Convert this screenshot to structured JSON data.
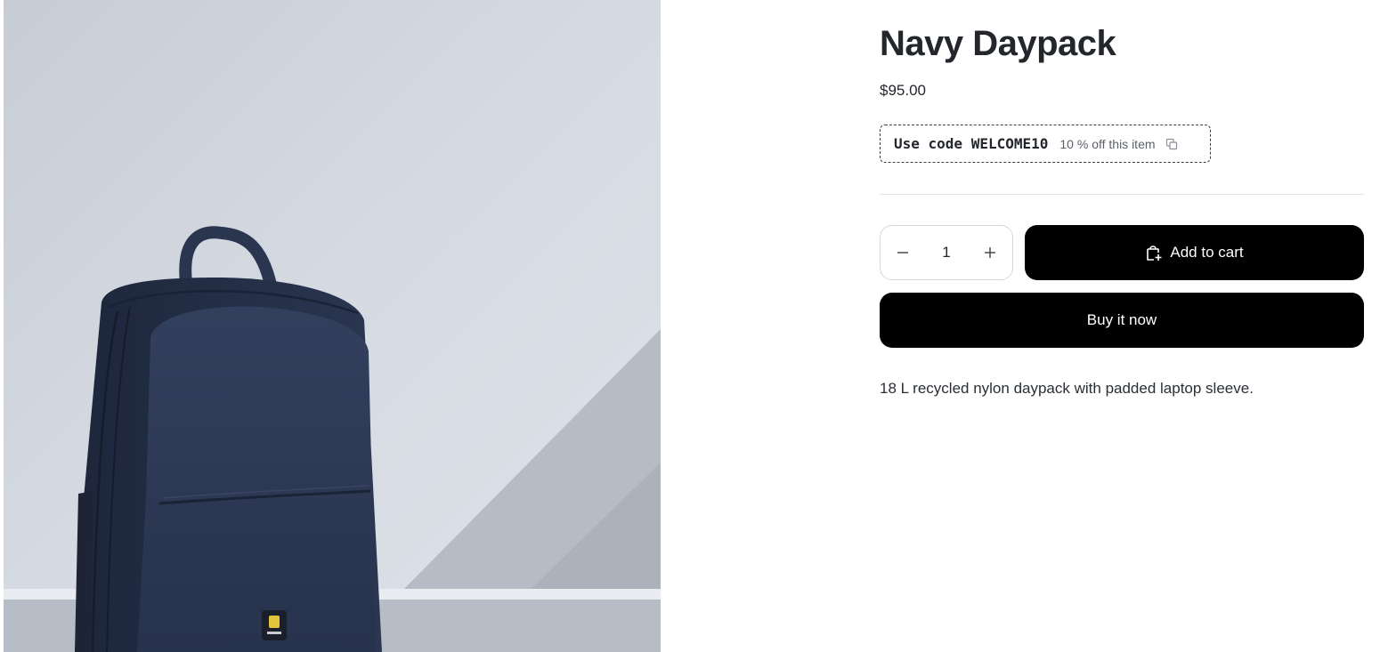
{
  "product": {
    "title": "Navy Daypack",
    "price": "$95.00",
    "description": "18 L recycled nylon daypack with padded laptop sleeve.",
    "image_alt": "Navy backpack on a grey floor against a light wall"
  },
  "coupon": {
    "code_text": "Use code WELCOME10",
    "description": "10 % off this item"
  },
  "quantity": {
    "value": "1"
  },
  "actions": {
    "add_to_cart_label": "Add to cart",
    "buy_now_label": "Buy it now"
  },
  "colors": {
    "button_bg": "#000000",
    "button_text": "#ffffff",
    "backpack": "#2a3550"
  },
  "icons": {
    "copy": "copy-icon",
    "minus": "minus-icon",
    "plus": "plus-icon",
    "cart": "shopping-bag-plus-icon"
  }
}
